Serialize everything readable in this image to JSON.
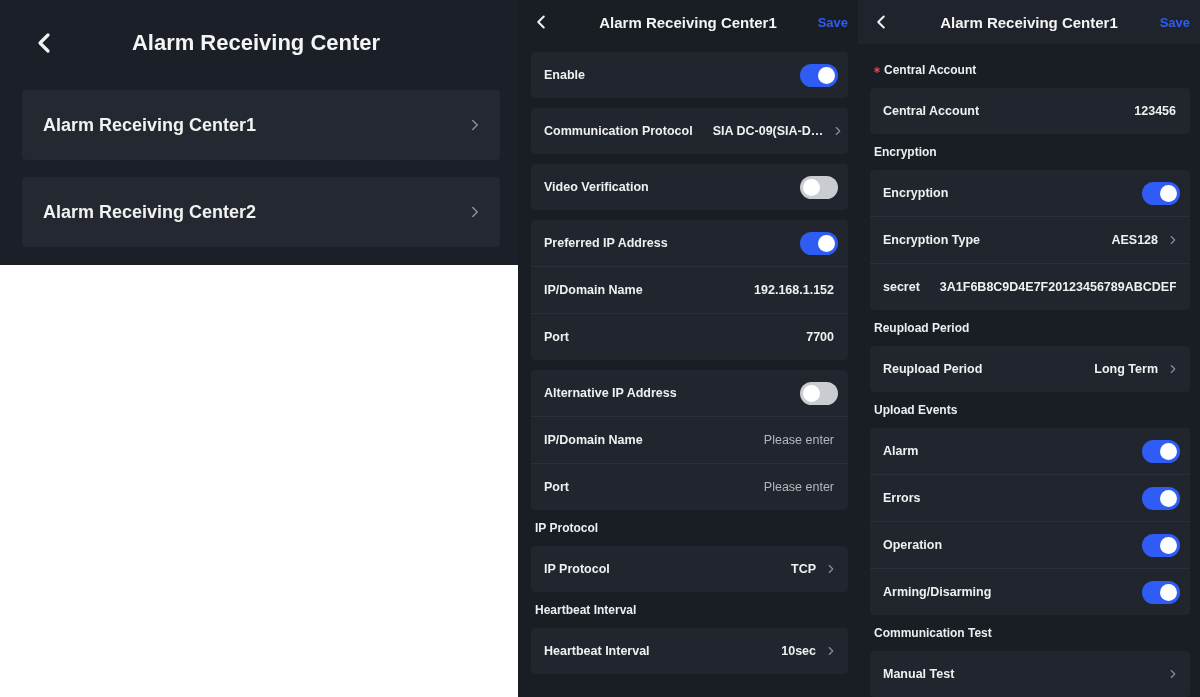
{
  "screens": [
    {
      "kind": "list",
      "title": "Alarm Receiving Center",
      "items": [
        {
          "label": "Alarm Receiving Center1"
        },
        {
          "label": "Alarm Receiving Center2"
        }
      ]
    },
    {
      "kind": "form",
      "title": "Alarm Receiving Center1",
      "save": "Save",
      "sections": [
        {
          "rows": [
            {
              "kind": "toggle",
              "label": "Enable",
              "on": true
            }
          ]
        },
        {
          "rows": [
            {
              "kind": "select",
              "label": "Communication Protocol",
              "value": "SIA DC-09(SIA-D…"
            }
          ]
        },
        {
          "rows": [
            {
              "kind": "toggle",
              "label": "Video Verification",
              "on": false
            }
          ]
        },
        {
          "rows": [
            {
              "kind": "toggle",
              "label": "Preferred IP Address",
              "on": true
            },
            {
              "kind": "field",
              "label": "IP/Domain Name",
              "value": "192.168.1.152"
            },
            {
              "kind": "field",
              "label": "Port",
              "value": "7700"
            }
          ]
        },
        {
          "rows": [
            {
              "kind": "toggle",
              "label": "Alternative IP Address",
              "on": false
            },
            {
              "kind": "field",
              "label": "IP/Domain Name",
              "placeholder": "Please enter"
            },
            {
              "kind": "field",
              "label": "Port",
              "placeholder": "Please enter"
            }
          ]
        },
        {
          "header": "IP Protocol",
          "rows": [
            {
              "kind": "select",
              "label": "IP Protocol",
              "value": "TCP"
            }
          ]
        },
        {
          "header": "Heartbeat Interval",
          "rows": [
            {
              "kind": "select",
              "label": "Heartbeat Interval",
              "value": "10sec"
            }
          ]
        }
      ]
    },
    {
      "kind": "form",
      "title": "Alarm Receiving Center1",
      "save": "Save",
      "sections": [
        {
          "header": "Central Account",
          "required": true,
          "rows": [
            {
              "kind": "field",
              "label": "Central Account",
              "value": "123456"
            }
          ]
        },
        {
          "header": "Encryption",
          "required": false,
          "rows": [
            {
              "kind": "toggle",
              "label": "Encryption",
              "on": true
            },
            {
              "kind": "select",
              "label": "Encryption Type",
              "value": "AES128"
            },
            {
              "kind": "field",
              "label": "secret",
              "value": "3A1F6B8C9D4E7F20123456789ABCDEF"
            }
          ]
        },
        {
          "header": "Reupload Period",
          "required": false,
          "rows": [
            {
              "kind": "select",
              "label": "Reupload Period",
              "value": "Long Term"
            }
          ]
        },
        {
          "header": "Upload Events",
          "required": false,
          "rows": [
            {
              "kind": "toggle",
              "label": "Alarm",
              "on": true
            },
            {
              "kind": "toggle",
              "label": "Errors",
              "on": true
            },
            {
              "kind": "toggle",
              "label": "Operation",
              "on": true
            },
            {
              "kind": "toggle",
              "label": "Arming/Disarming",
              "on": true
            }
          ]
        },
        {
          "header": "Communication Test",
          "required": false,
          "rows": [
            {
              "kind": "select",
              "label": "Manual Test"
            }
          ]
        }
      ]
    }
  ]
}
